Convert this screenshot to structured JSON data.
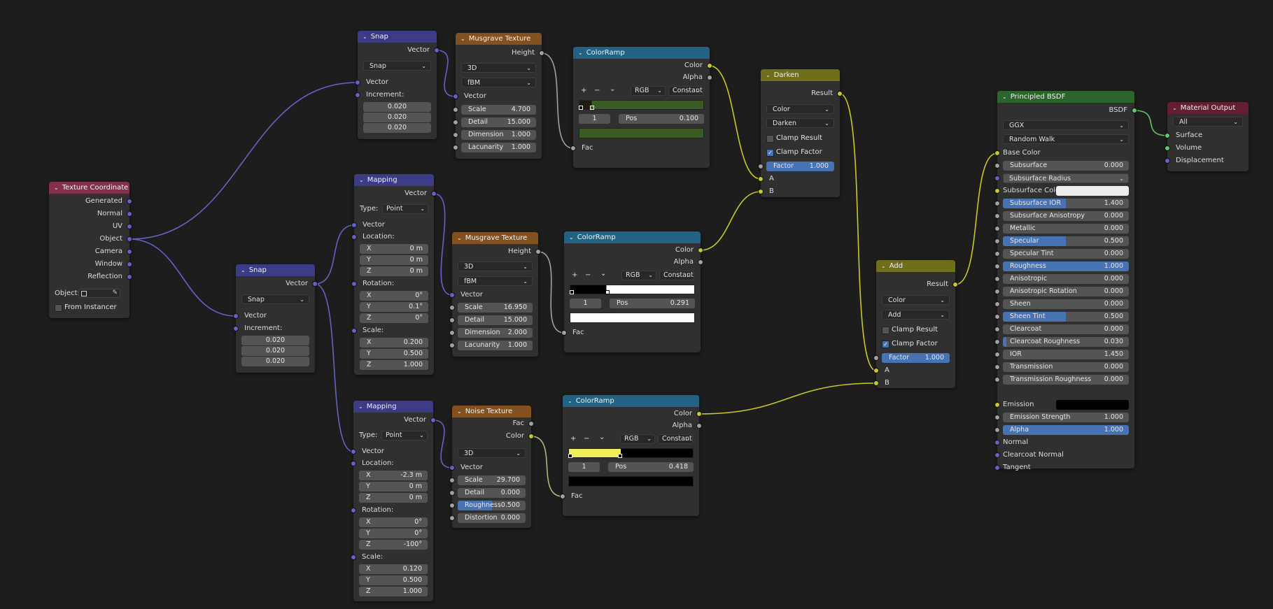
{
  "colors": {
    "background": "#1d1d1d",
    "node_body": "#303030",
    "header_input": "#83314a",
    "header_converter": "#3b3b86",
    "header_texture": "#83501f",
    "header_colorramp": "#246283",
    "header_color": "#6e6e1d",
    "header_shader": "#2b652b",
    "header_output": "#631f31",
    "socket_vector": "#6363c7",
    "socket_color": "#c7c729",
    "socket_float": "#a1a1a1",
    "socket_shader": "#63c763",
    "field_blue": "#4772b3"
  },
  "texcoord": {
    "title": "Texture Coordinate",
    "outputs": [
      "Generated",
      "Normal",
      "UV",
      "Object",
      "Camera",
      "Window",
      "Reflection"
    ],
    "object_label": "Object:",
    "from_instancer": "From Instancer"
  },
  "snap1": {
    "title": "Snap",
    "output": "Vector",
    "mode": "Snap",
    "input_vector": "Vector",
    "increment_label": "Increment:",
    "increments": [
      "0.020",
      "0.020",
      "0.020"
    ]
  },
  "snap2": {
    "title": "Snap",
    "output": "Vector",
    "mode": "Snap",
    "input_vector": "Vector",
    "increment_label": "Increment:",
    "increments": [
      "0.020",
      "0.020",
      "0.020"
    ]
  },
  "mapping1": {
    "title": "Mapping",
    "output": "Vector",
    "type_label": "Type:",
    "type_value": "Point",
    "input_vector": "Vector",
    "location_label": "Location:",
    "location": [
      [
        "X",
        "0 m"
      ],
      [
        "Y",
        "0 m"
      ],
      [
        "Z",
        "0 m"
      ]
    ],
    "rotation_label": "Rotation:",
    "rotation": [
      [
        "X",
        "0°"
      ],
      [
        "Y",
        "0.1°"
      ],
      [
        "Z",
        "0°"
      ]
    ],
    "scale_label": "Scale:",
    "scale": [
      [
        "X",
        "0.200"
      ],
      [
        "Y",
        "0.500"
      ],
      [
        "Z",
        "1.000"
      ]
    ]
  },
  "mapping2": {
    "title": "Mapping",
    "output": "Vector",
    "type_label": "Type:",
    "type_value": "Point",
    "input_vector": "Vector",
    "location_label": "Location:",
    "location": [
      [
        "X",
        "-2.3 m"
      ],
      [
        "Y",
        "0 m"
      ],
      [
        "Z",
        "0 m"
      ]
    ],
    "rotation_label": "Rotation:",
    "rotation": [
      [
        "X",
        "0°"
      ],
      [
        "Y",
        "0°"
      ],
      [
        "Z",
        "-100°"
      ]
    ],
    "scale_label": "Scale:",
    "scale": [
      [
        "X",
        "0.120"
      ],
      [
        "Y",
        "0.500"
      ],
      [
        "Z",
        "1.000"
      ]
    ]
  },
  "musgrave1": {
    "title": "Musgrave Texture",
    "output": "Height",
    "dim": "3D",
    "type": "fBM",
    "input_vector": "Vector",
    "params": [
      [
        "Scale",
        "4.700"
      ],
      [
        "Detail",
        "15.000"
      ],
      [
        "Dimension",
        "1.000"
      ],
      [
        "Lacunarity",
        "1.000"
      ]
    ]
  },
  "musgrave2": {
    "title": "Musgrave Texture",
    "output": "Height",
    "dim": "3D",
    "type": "fBM",
    "input_vector": "Vector",
    "params": [
      [
        "Scale",
        "16.950"
      ],
      [
        "Detail",
        "15.000"
      ],
      [
        "Dimension",
        "2.000"
      ],
      [
        "Lacunarity",
        "1.000"
      ]
    ]
  },
  "noise": {
    "title": "Noise Texture",
    "outputs": [
      "Fac",
      "Color"
    ],
    "dim": "3D",
    "input_vector": "Vector",
    "params": [
      [
        "Scale",
        "29.700"
      ],
      [
        "Detail",
        "0.000"
      ],
      [
        "Roughness",
        "0.500"
      ],
      [
        "Distortion",
        "0.000"
      ]
    ],
    "roughness_level": 0.5
  },
  "ramp1": {
    "title": "ColorRamp",
    "outputs": [
      "Color",
      "Alpha"
    ],
    "plus": "+",
    "minus": "−",
    "more": "⌄",
    "mode": "RGB",
    "interp": "Constant",
    "index": "1",
    "pos_label": "Pos",
    "pos_value": "0.100",
    "input": "Fac",
    "color_a": "#1c1c10",
    "color_b": "#3c5a23",
    "swatch": "#3c5a23"
  },
  "ramp2": {
    "title": "ColorRamp",
    "outputs": [
      "Color",
      "Alpha"
    ],
    "plus": "+",
    "minus": "−",
    "more": "⌄",
    "mode": "RGB",
    "interp": "Constant",
    "index": "1",
    "pos_label": "Pos",
    "pos_value": "0.291",
    "input": "Fac",
    "color_a": "#000000",
    "color_b": "#ffffff",
    "swatch": "#ffffff"
  },
  "ramp3": {
    "title": "ColorRamp",
    "outputs": [
      "Color",
      "Alpha"
    ],
    "plus": "+",
    "minus": "−",
    "more": "⌄",
    "mode": "RGB",
    "interp": "Constant",
    "index": "1",
    "pos_label": "Pos",
    "pos_value": "0.418",
    "input": "Fac",
    "color_a": "#f2ef5a",
    "color_b": "#000000",
    "swatch": "#000000"
  },
  "darken": {
    "title": "Darken",
    "output": "Result",
    "type": "Color",
    "blend": "Darken",
    "clamp_result": "Clamp Result",
    "clamp_factor": "Clamp Factor",
    "factor_label": "Factor",
    "factor_value": "1.000",
    "input_a": "A",
    "input_b": "B"
  },
  "add": {
    "title": "Add",
    "output": "Result",
    "type": "Color",
    "blend": "Add",
    "clamp_result": "Clamp Result",
    "clamp_factor": "Clamp Factor",
    "factor_label": "Factor",
    "factor_value": "1.000",
    "input_a": "A",
    "input_b": "B"
  },
  "bsdf": {
    "title": "Principled BSDF",
    "output": "BSDF",
    "distribution": "GGX",
    "subsurface_method": "Random Walk",
    "base_color": "Base Color",
    "subsurface": [
      "Subsurface",
      "0.000"
    ],
    "subsurface_radius": "Subsurface Radius",
    "subsurface_color": "Subsurface Color",
    "params": [
      [
        "Subsurface IOR",
        "1.400",
        0.5
      ],
      [
        "Subsurface Anisotropy",
        "0.000",
        0
      ],
      [
        "Metallic",
        "0.000",
        0
      ],
      [
        "Specular",
        "0.500",
        0.5
      ],
      [
        "Specular Tint",
        "0.000",
        0
      ],
      [
        "Roughness",
        "1.000",
        1
      ],
      [
        "Anisotropic",
        "0.000",
        0
      ],
      [
        "Anisotropic Rotation",
        "0.000",
        0
      ],
      [
        "Sheen",
        "0.000",
        0
      ],
      [
        "Sheen Tint",
        "0.500",
        0.5
      ],
      [
        "Clearcoat",
        "0.000",
        0
      ],
      [
        "Clearcoat Roughness",
        "0.030",
        0.03
      ],
      [
        "IOR",
        "1.450",
        0
      ],
      [
        "Transmission",
        "0.000",
        0
      ],
      [
        "Transmission Roughness",
        "0.000",
        0
      ]
    ],
    "emission": "Emission",
    "emission_strength": [
      "Emission Strength",
      "1.000"
    ],
    "alpha": [
      "Alpha",
      "1.000"
    ],
    "vec_inputs": [
      "Normal",
      "Clearcoat Normal",
      "Tangent"
    ]
  },
  "output": {
    "title": "Material Output",
    "target": "All",
    "inputs": [
      "Surface",
      "Volume",
      "Displacement"
    ]
  }
}
